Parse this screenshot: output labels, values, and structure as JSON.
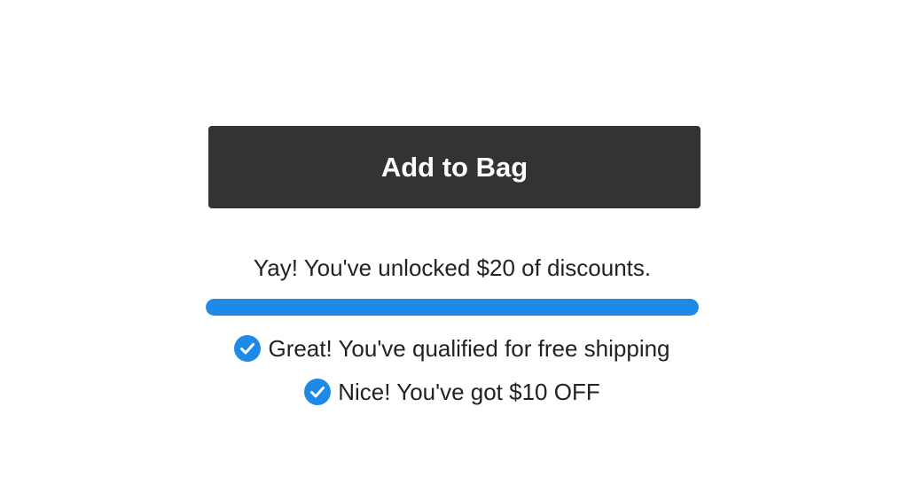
{
  "colors": {
    "button_bg": "#333333",
    "button_text": "#ffffff",
    "accent": "#1e8ae8",
    "text": "#222222"
  },
  "cart": {
    "add_button_label": "Add to Bag"
  },
  "discount": {
    "message": "Yay! You've unlocked $20 of discounts.",
    "progress_fraction": 1.0
  },
  "perks": [
    {
      "icon": "check-circle-icon",
      "text": "Great! You've qualified for free shipping"
    },
    {
      "icon": "check-circle-icon",
      "text": "Nice! You've got $10 OFF"
    }
  ]
}
